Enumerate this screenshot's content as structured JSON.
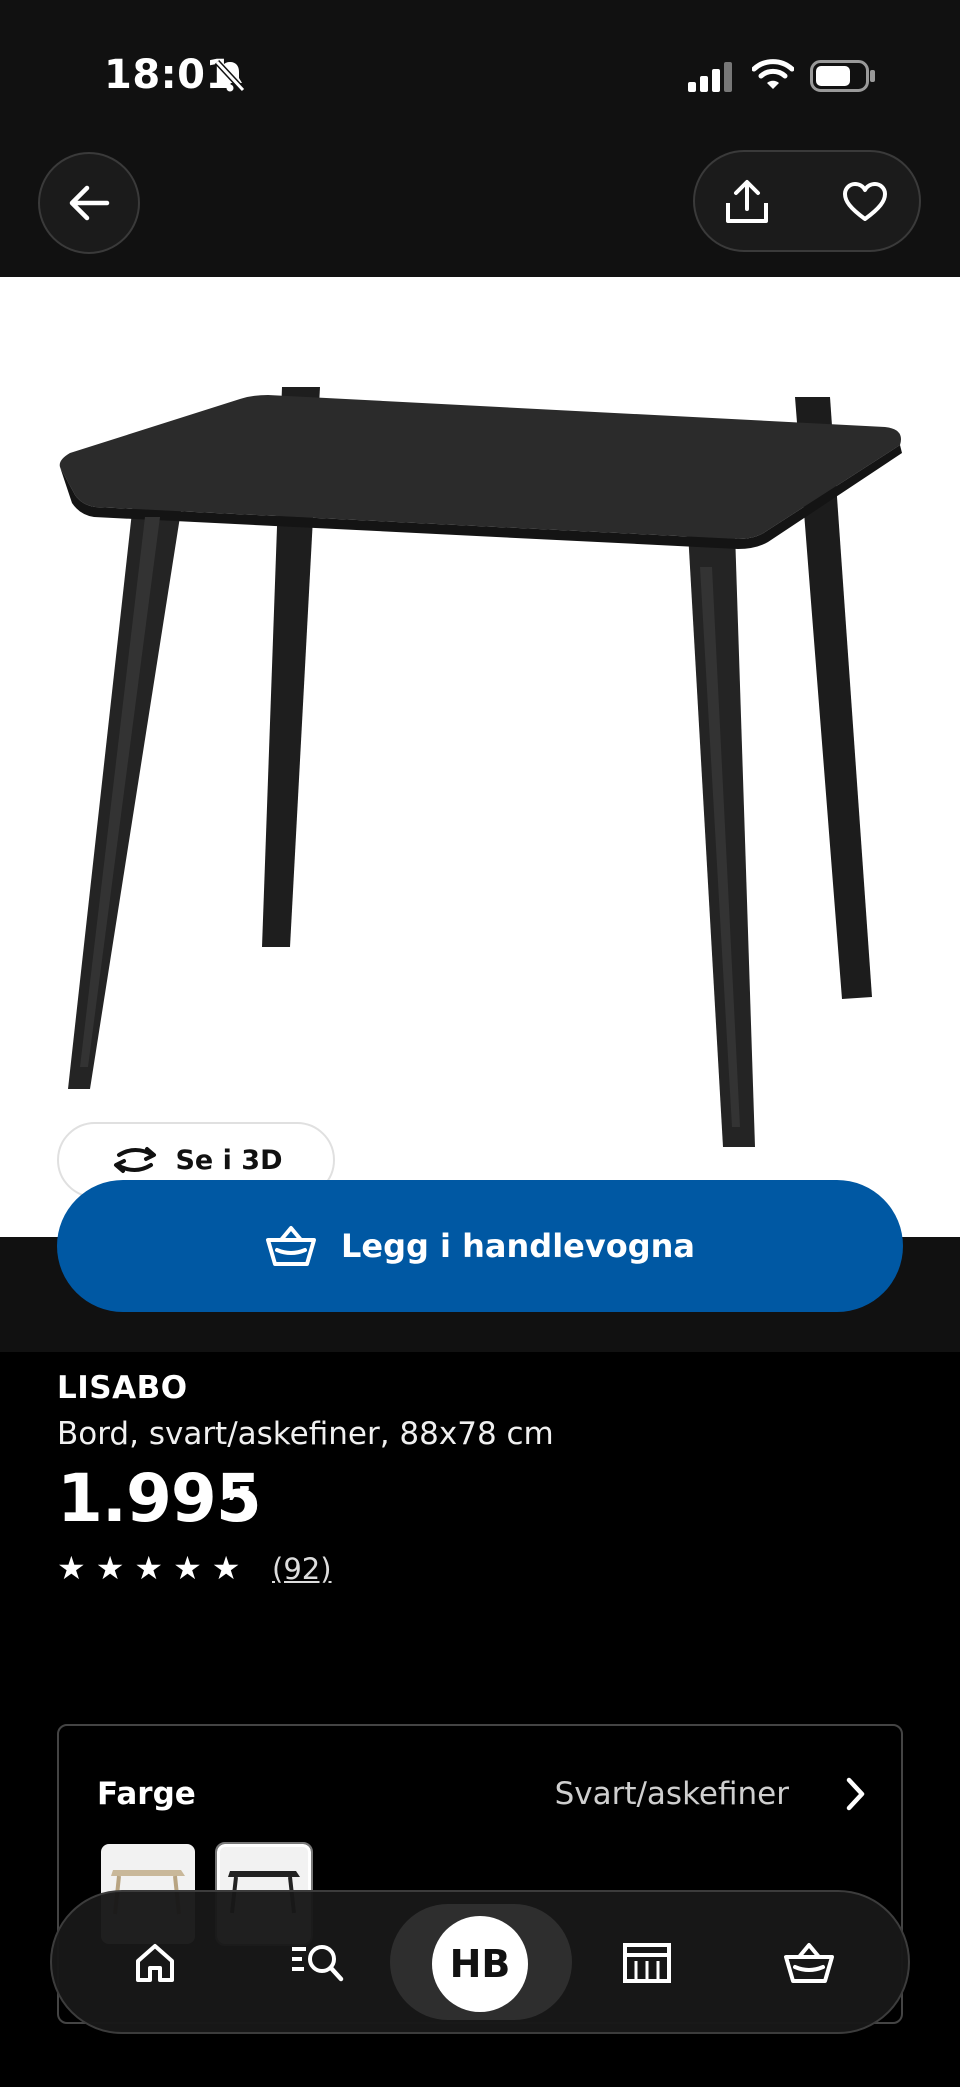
{
  "status_bar": {
    "time": "18:01"
  },
  "product": {
    "view_3d_label": "Se i 3D",
    "add_to_cart_label": "Legg i handlevogna",
    "name": "LISABO",
    "description": "Bord, svart/askefiner, 88x78 cm",
    "price": "1.995",
    "price_suffix": ",-",
    "rating": 5,
    "review_count": "(92)"
  },
  "color_selector": {
    "label": "Farge",
    "selected_value": "Svart/askefiner",
    "swatches": [
      "light-ash-table",
      "black-table"
    ]
  },
  "bottom_nav": {
    "profile_initials": "HB",
    "items": [
      "home-icon",
      "search-icon",
      "profile",
      "store-icon",
      "cart-icon"
    ]
  },
  "colors": {
    "accent": "#0058a3",
    "background": "#000000",
    "bar": "#111111"
  }
}
